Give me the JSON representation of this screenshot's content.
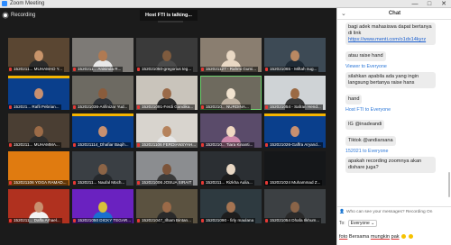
{
  "window": {
    "title": "Zoom Meeting",
    "minimize": "—",
    "maximize": "□",
    "close": "✕"
  },
  "recording": {
    "label": "Recording"
  },
  "talking": {
    "label": "Host FTI is talking..."
  },
  "tiles": [
    {
      "name": "1520211... MUHAMAD Y...",
      "bg": "#5a4632",
      "skin": "#c8946a",
      "shirt": "#2b2b2b",
      "banner": false,
      "mic_muted": true
    },
    {
      "name": "1520211... Anisinda R...",
      "bg": "#7d7a76",
      "skin": "#b07a52",
      "shirt": "#e8e8e8",
      "banner": false,
      "mic_muted": true
    },
    {
      "name": "152021050-gregorius teg...",
      "bg": "#3a3a3a",
      "skin": "#7f5b3e",
      "shirt": "#4b4b4b",
      "banner": false,
      "mic_muted": true
    },
    {
      "name": "152021127 - Rahmi Gumi...",
      "bg": "#8a7e70",
      "skin": "#e9d8c4",
      "shirt": "#e9d8c4",
      "banner": false,
      "mic_muted": true
    },
    {
      "name": "152021065 - Miftah nug...",
      "bg": "#3d4a55",
      "skin": "#b98862",
      "shirt": "#1f2b36",
      "banner": false,
      "mic_muted": true
    },
    {
      "name": "152021... Rafli Pebrian...",
      "bg": "#0a3f8c",
      "skin": "#c89070",
      "shirt": "#0a3f8c",
      "banner": true,
      "mic_muted": true
    },
    {
      "name": "152021036-Arifinizar Yud...",
      "bg": "#6d6a62",
      "skin": "#8a5c3c",
      "shirt": "#30343a",
      "banner": false,
      "mic_muted": true
    },
    {
      "name": "152021091-Ferdi Gandika...",
      "bg": "#c9c4bb",
      "skin": "#9a6a48",
      "shirt": "#2e2e2e",
      "banner": false,
      "mic_muted": true
    },
    {
      "name": "1520210... NURDINA...",
      "bg": "#6e6a5e",
      "skin": "#f1e3cf",
      "shirt": "#bfb2a2",
      "banner": false,
      "mic_muted": true,
      "active": true
    },
    {
      "name": "152021054 - Safran Hend...",
      "bg": "#cfd3d6",
      "skin": "#9b6a44",
      "shirt": "#3a3a3a",
      "banner": false,
      "mic_muted": true
    },
    {
      "name": "1520211... MUHAMMA...",
      "bg": "#4a3e33",
      "skin": "#9c6b47",
      "shirt": "#2e2e2e",
      "banner": false,
      "mic_muted": true
    },
    {
      "name": "152021114_Dhafiar Baqih...",
      "bg": "#0a3f8c",
      "skin": "#c89070",
      "shirt": "#0a3f8c",
      "banner": true,
      "mic_muted": true
    },
    {
      "name": "152021106 FERDIANSYAH...",
      "bg": "#d8d4ce",
      "skin": "#b5825c",
      "shirt": "#e6e6e6",
      "banner": false,
      "mic_muted": true
    },
    {
      "name": "1520210... Tiara Kinanti...",
      "bg": "#5a4b6a",
      "skin": "#f0d9c2",
      "shirt": "#cc88aa",
      "banner": false,
      "mic_muted": true
    },
    {
      "name": "152021026-Gaffra Aryand...",
      "bg": "#0a3f8c",
      "skin": "#c89070",
      "shirt": "#0a3f8c",
      "banner": true,
      "mic_muted": true
    },
    {
      "name": "152021106 YOGA RAMAD...",
      "bg": "#e07b10",
      "skin": "#e07b10",
      "shirt": "#e07b10",
      "banner": false,
      "mic_muted": true,
      "blank": true
    },
    {
      "name": "1520211... Naufal Moch...",
      "bg": "#3a3f44",
      "skin": "#8c6446",
      "shirt": "#26292c",
      "banner": false,
      "mic_muted": true
    },
    {
      "name": "152021006 JOSUA SIRAIT",
      "bg": "#8b8d90",
      "skin": "#7c543a",
      "shirt": "#3a3a3a",
      "banner": false,
      "mic_muted": true
    },
    {
      "name": "1520211... Rizkha Aulia...",
      "bg": "#2b2f33",
      "skin": "#e9d8c4",
      "shirt": "#1c1c1c",
      "banner": false,
      "mic_muted": true
    },
    {
      "name": "152021024 Muhammad Z...",
      "bg": "#151719",
      "skin": "#151719",
      "shirt": "#151719",
      "banner": false,
      "mic_muted": true,
      "blank": true
    },
    {
      "name": "1520211... Daffa Arhael...",
      "bg": "#b0311f",
      "skin": "#c89070",
      "shirt": "#f2f2f2",
      "banner": false,
      "mic_muted": true
    },
    {
      "name": "152021050 DICKY TEGAR...",
      "bg": "#6a22c0",
      "skin": "#d8c03c",
      "shirt": "#1a6fd0",
      "banner": false,
      "mic_muted": true
    },
    {
      "name": "152021047_Ilham Bintan...",
      "bg": "#5b5240",
      "skin": "#9b6a48",
      "shirt": "#2a2a2a",
      "banner": false,
      "mic_muted": true
    },
    {
      "name": "152021090 - firly maulana",
      "bg": "#2e3a40",
      "skin": "#a57452",
      "shirt": "#1d1d1d",
      "banner": false,
      "mic_muted": true
    },
    {
      "name": "152021054 Dhafa Ilkhum...",
      "bg": "#3c4043",
      "skin": "#8a6448",
      "shirt": "#2a2a2a",
      "banner": false,
      "mic_muted": true
    }
  ],
  "chat": {
    "title": "Chat",
    "collapse": "⌄",
    "messages": [
      {
        "sender": "",
        "text": "bagi adek mahasiswa dapat bertanya di link",
        "link": "https://www.menti.com/o1dx14kyrz"
      },
      {
        "sender": "",
        "text": "atau raise hand"
      },
      {
        "sender": "Viewer to Everyone",
        "text": "silahkan apabila ada yang ingin langsung bertanya raise hans"
      },
      {
        "sender": "",
        "text": "hand"
      },
      {
        "sender": "Host FTI to Everyone",
        "text": "IG @inadeandi"
      },
      {
        "sender": "",
        "text": "Tiktok @andiarsana"
      },
      {
        "sender": "152021 to Everyone",
        "text": "apakah recording zoomnya akan dishare juga?"
      }
    ],
    "who_can_see": "Who can see your messages? Recording On",
    "to_label": "To:",
    "to_value": "Everyone",
    "input_text": "foto",
    "input_rest": "Bersama",
    "input_mid": "mungkin",
    "input_tail": "pak"
  }
}
